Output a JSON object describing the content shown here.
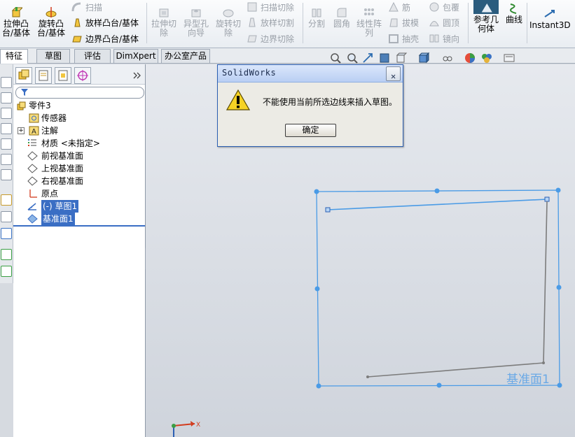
{
  "ribbon": {
    "extrude_boss": "拉伸凸\n台/基体",
    "revolve_boss": "旋转凸\n台/基体",
    "sweep": "扫描",
    "loft_boss": "放样凸台/基体",
    "boundary_boss": "边界凸台/基体",
    "extrude_cut": "拉伸切\n除",
    "hole_wizard": "异型孔\n向导",
    "revolve_cut": "旋转切\n除",
    "swept_cut": "扫描切除",
    "lofted_cut": "放样切割",
    "boundary_cut": "边界切除",
    "split": "分割",
    "fillet": "圆角",
    "linear_pattern": "线性阵\n列",
    "rib": "筋",
    "draft": "拔模",
    "shell": "抽壳",
    "wrap": "包覆",
    "dome": "圆顶",
    "mirror": "镜向",
    "ref_geometry": "参考几\n何体",
    "curves": "曲线",
    "instant3d": "Instant3D"
  },
  "tabs": [
    "特征",
    "草图",
    "评估",
    "DimXpert",
    "办公室产品"
  ],
  "active_tab": "特征",
  "tree": {
    "root": "零件3",
    "sensors": "传感器",
    "annotations": "注解",
    "material": "材质 <未指定>",
    "front_plane": "前视基准面",
    "top_plane": "上视基准面",
    "right_plane": "右视基准面",
    "origin": "原点",
    "sketch": "(-) 草图1",
    "plane1": "基准面1"
  },
  "dialog": {
    "title": "SolidWorks",
    "message": "不能使用当前所选边线来插入草图。",
    "ok_label": "确定",
    "close_glyph": "✕"
  },
  "viewport": {
    "plane_label": "基准面1",
    "axis_x": "X"
  },
  "colors": {
    "selection": "#3a6ec4",
    "plane": "#4a9be6",
    "sketch": "#7c7c7c"
  }
}
